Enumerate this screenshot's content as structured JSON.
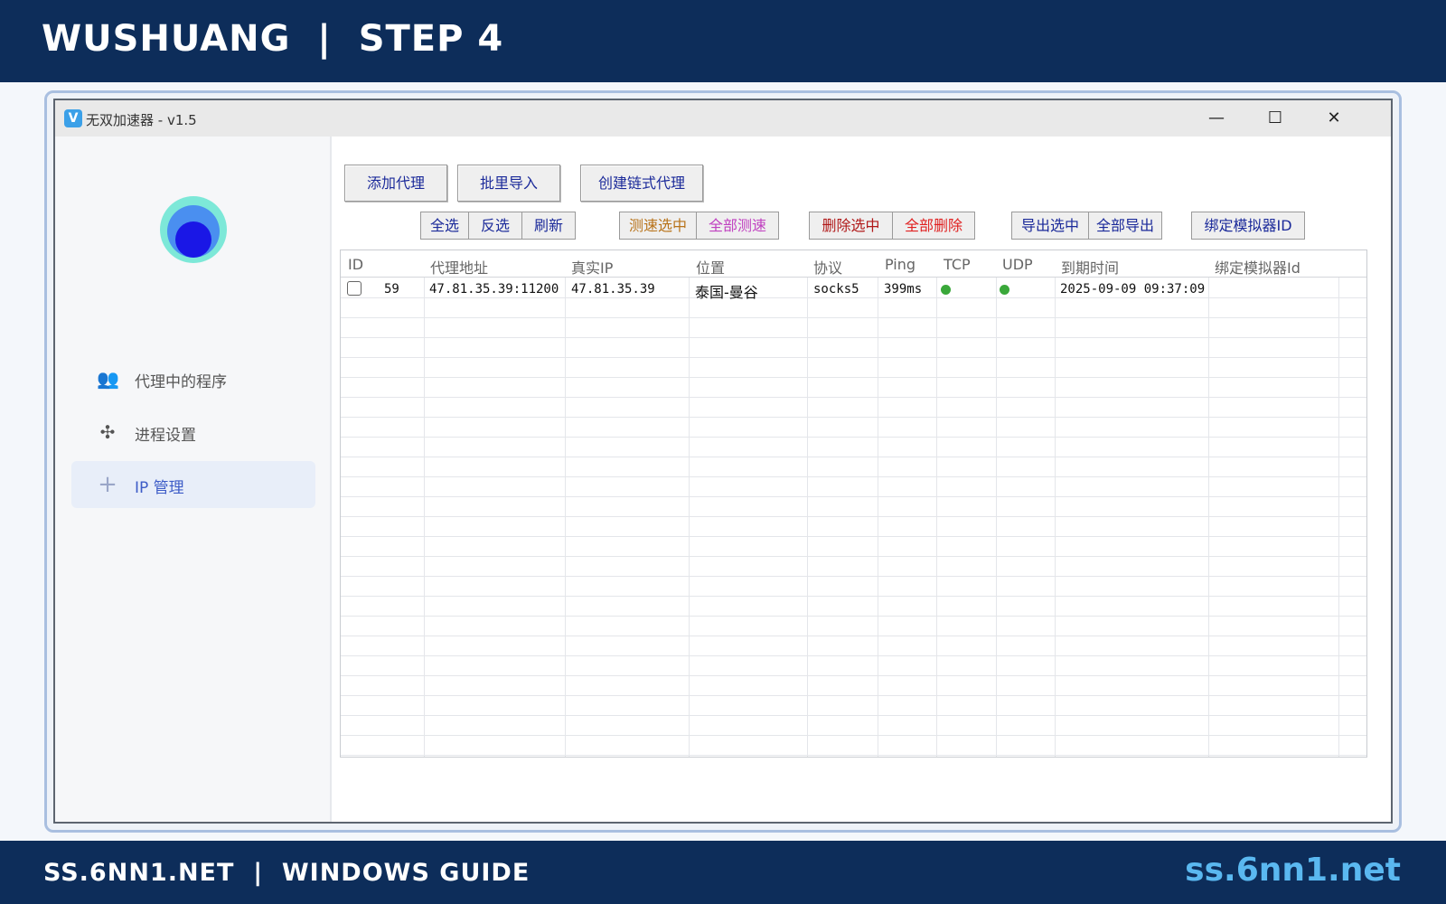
{
  "banner": {
    "title": "WUSHUANG  |  STEP 4",
    "footer_left": "SS.6NN1.NET  |  WINDOWS GUIDE",
    "footer_right": "ss.6nn1.net"
  },
  "window": {
    "icon_letter": "V",
    "title": "无双加速器 - v1.5",
    "controls": {
      "minimize": "—",
      "maximize": "☐",
      "close": "✕"
    }
  },
  "sidebar": {
    "items": [
      {
        "label": "代理中的程序",
        "icon": "users-icon",
        "glyph": "👥"
      },
      {
        "label": "进程设置",
        "icon": "fan-icon",
        "glyph": "✣"
      },
      {
        "label": "IP 管理",
        "icon": "plus-icon",
        "glyph": "+"
      }
    ],
    "active_index": 2
  },
  "toolbar": {
    "add_proxy": "添加代理",
    "batch_import": "批里导入",
    "create_chain": "创建链式代理",
    "select_all": "全选",
    "invert_select": "反选",
    "refresh": "刷新",
    "test_selected": "测速选中",
    "test_all": "全部测速",
    "delete_selected": "删除选中",
    "delete_all": "全部删除",
    "export_selected": "导出选中",
    "export_all": "全部导出",
    "bind_emulator": "绑定模拟器ID"
  },
  "colors": {
    "banner_bg": "#0d2d5a",
    "footer_link": "#5ab8f0",
    "btn_blue": "#1b2a9a",
    "btn_orange": "#b8731a",
    "btn_magenta": "#c040c0",
    "btn_red_dark": "#b01818",
    "btn_red": "#e02020",
    "status_green": "#3aa83a"
  },
  "table": {
    "headers": {
      "id": "ID",
      "address": "代理地址",
      "real_ip": "真实IP",
      "location": "位置",
      "protocol": "协议",
      "ping": "Ping",
      "tcp": "TCP",
      "udp": "UDP",
      "expire": "到期时间",
      "emulator": "绑定模拟器Id"
    },
    "rows": [
      {
        "checked": false,
        "id": "59",
        "address": "47.81.35.39:11200",
        "real_ip": "47.81.35.39",
        "location": "泰国-曼谷",
        "protocol": "socks5",
        "ping": "399ms",
        "tcp": "ok",
        "udp": "ok",
        "expire": "2025-09-09 09:37:09",
        "emulator": ""
      }
    ]
  }
}
